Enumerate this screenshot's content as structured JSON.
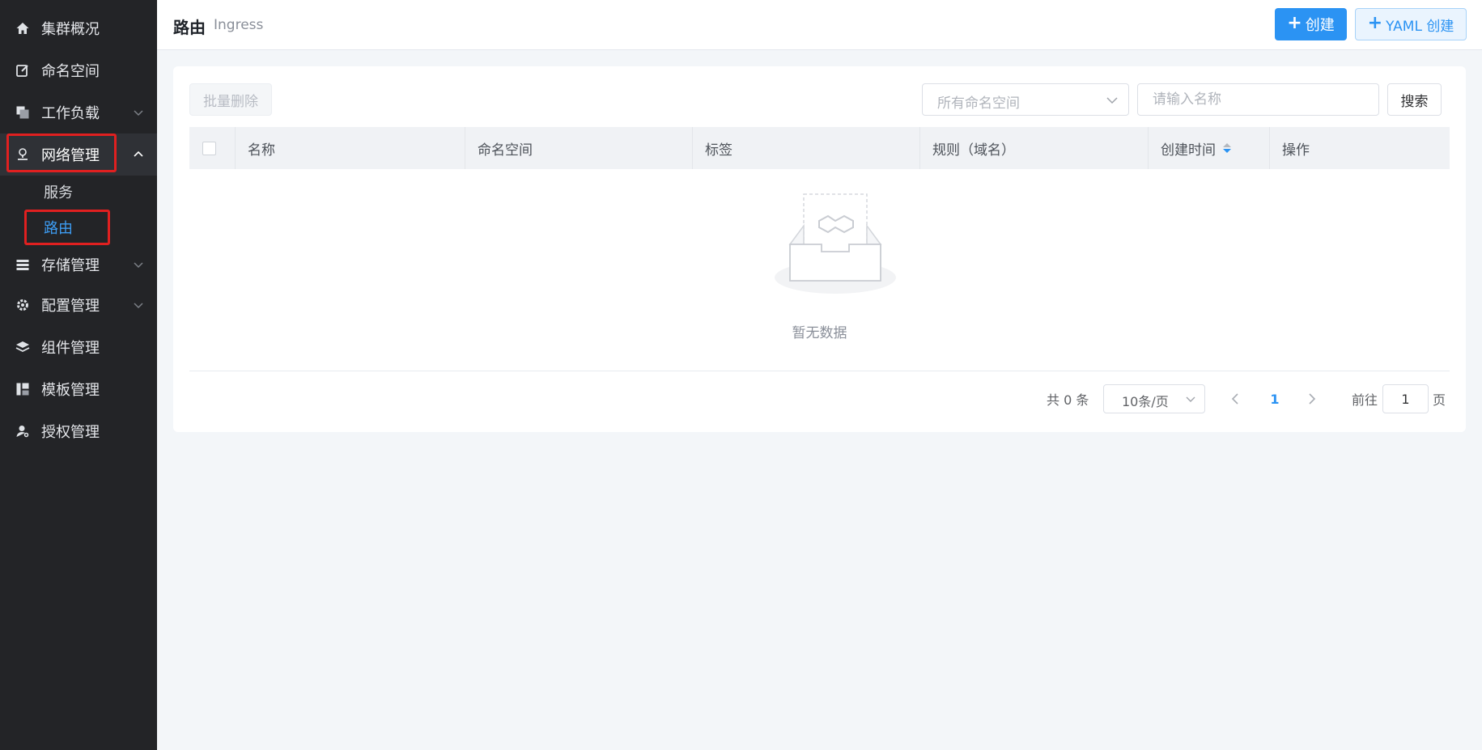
{
  "sidebar": {
    "items": [
      {
        "label": "集群概况",
        "icon": "home-icon"
      },
      {
        "label": "命名空间",
        "icon": "edit-icon"
      },
      {
        "label": "工作负载",
        "icon": "copy-icon"
      },
      {
        "label": "网络管理",
        "icon": "network-icon",
        "expanded": true
      },
      {
        "label": "存储管理",
        "icon": "storage-icon"
      },
      {
        "label": "配置管理",
        "icon": "gear-icon"
      },
      {
        "label": "组件管理",
        "icon": "layers-icon"
      },
      {
        "label": "模板管理",
        "icon": "template-icon"
      },
      {
        "label": "授权管理",
        "icon": "user-key-icon"
      }
    ],
    "network_children": [
      {
        "label": "服务"
      },
      {
        "label": "路由",
        "active": true
      }
    ]
  },
  "header": {
    "title": "路由",
    "subtitle": "Ingress",
    "create_label": "创建",
    "yaml_create_label": "YAML 创建"
  },
  "toolbar": {
    "batch_delete_label": "批量删除",
    "namespace_placeholder": "所有命名空间",
    "name_placeholder": "请输入名称",
    "search_label": "搜索"
  },
  "table": {
    "columns": [
      "名称",
      "命名空间",
      "标签",
      "规则（域名）",
      "创建时间",
      "操作"
    ],
    "rows": [],
    "empty_text": "暂无数据"
  },
  "pagination": {
    "total_text": "共 0 条",
    "page_size": "10条/页",
    "current_page": "1",
    "goto_label": "前往",
    "goto_value": "1",
    "page_suffix": "页"
  },
  "colors": {
    "accent": "#2b93f3",
    "sidebar_bg": "#232427",
    "highlight_border": "#e02020"
  }
}
